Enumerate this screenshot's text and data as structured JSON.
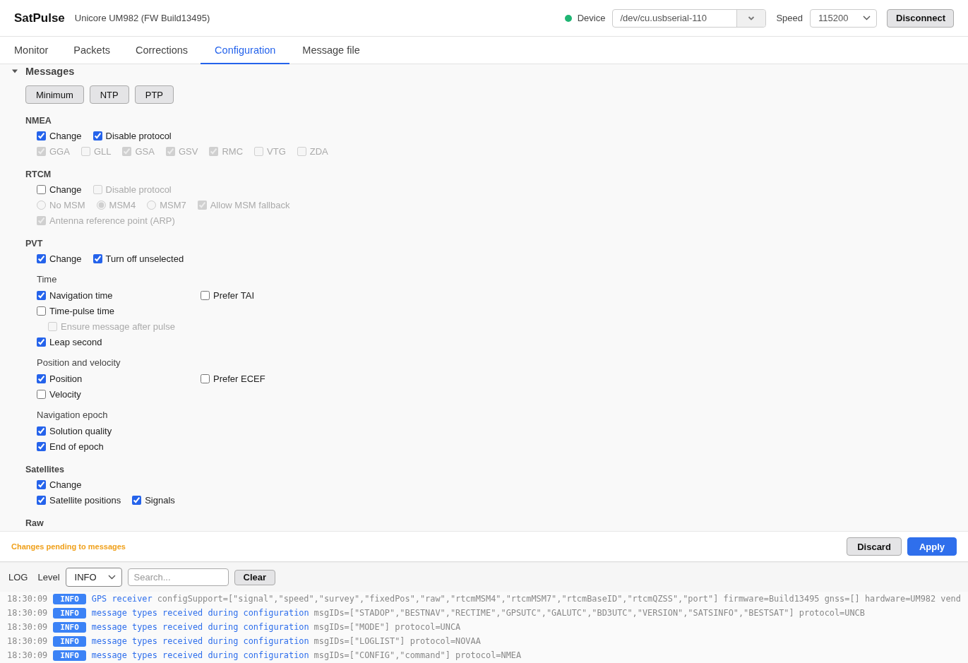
{
  "app": {
    "title": "SatPulse",
    "subtitle": "Unicore UM982 (FW Build13495)"
  },
  "connection": {
    "connected": true,
    "device_label": "Device",
    "device": "/dev/cu.usbserial-110",
    "speed_label": "Speed",
    "speed": "115200",
    "button": "Disconnect"
  },
  "tabs": [
    {
      "label": "Monitor",
      "selected": false
    },
    {
      "label": "Packets",
      "selected": false
    },
    {
      "label": "Corrections",
      "selected": false
    },
    {
      "label": "Configuration",
      "selected": true
    },
    {
      "label": "Message file",
      "selected": false
    }
  ],
  "messages": {
    "title": "Messages",
    "expanded": true,
    "presets": [
      "Minimum",
      "NTP",
      "PTP"
    ],
    "groups": [
      {
        "title": "NMEA",
        "rows": [
          [
            {
              "kind": "checkbox",
              "label": "Change",
              "checked": true,
              "disabled": false
            },
            {
              "kind": "checkbox",
              "label": "Disable protocol",
              "checked": true,
              "disabled": false
            }
          ],
          [
            {
              "kind": "checkbox",
              "label": "GGA",
              "checked": true,
              "disabled": true
            },
            {
              "kind": "checkbox",
              "label": "GLL",
              "checked": false,
              "disabled": true
            },
            {
              "kind": "checkbox",
              "label": "GSA",
              "checked": true,
              "disabled": true
            },
            {
              "kind": "checkbox",
              "label": "GSV",
              "checked": true,
              "disabled": true
            },
            {
              "kind": "checkbox",
              "label": "RMC",
              "checked": true,
              "disabled": true
            },
            {
              "kind": "checkbox",
              "label": "VTG",
              "checked": false,
              "disabled": true
            },
            {
              "kind": "checkbox",
              "label": "ZDA",
              "checked": false,
              "disabled": true
            }
          ]
        ]
      },
      {
        "title": "RTCM",
        "rows": [
          [
            {
              "kind": "checkbox",
              "label": "Change",
              "checked": false,
              "disabled": false
            },
            {
              "kind": "checkbox",
              "label": "Disable protocol",
              "checked": false,
              "disabled": true
            }
          ],
          [
            {
              "kind": "radio",
              "label": "No MSM",
              "selected": false,
              "disabled": true
            },
            {
              "kind": "radio",
              "label": "MSM4",
              "selected": true,
              "disabled": true
            },
            {
              "kind": "radio",
              "label": "MSM7",
              "selected": false,
              "disabled": true
            },
            {
              "kind": "checkbox",
              "label": "Allow MSM fallback",
              "checked": true,
              "disabled": true
            }
          ],
          [
            {
              "kind": "checkbox",
              "label": "Antenna reference point (ARP)",
              "checked": true,
              "disabled": true
            }
          ]
        ]
      },
      {
        "title": "PVT",
        "rows": [
          [
            {
              "kind": "checkbox",
              "label": "Change",
              "checked": true,
              "disabled": false
            },
            {
              "kind": "checkbox",
              "label": "Turn off unselected",
              "checked": true,
              "disabled": false
            }
          ]
        ],
        "subgroups": [
          {
            "title": "Time",
            "rows": [
              [
                {
                  "kind": "checkbox",
                  "label": "Navigation time",
                  "checked": true,
                  "disabled": false
                },
                {
                  "kind": "checkbox",
                  "label": "Prefer TAI",
                  "checked": false,
                  "disabled": false
                }
              ],
              [
                {
                  "kind": "checkbox",
                  "label": "Time-pulse time",
                  "checked": false,
                  "disabled": false,
                  "children": [
                    {
                      "kind": "checkbox",
                      "label": "Ensure message after pulse",
                      "checked": false,
                      "disabled": true
                    }
                  ]
                }
              ],
              [
                {
                  "kind": "checkbox",
                  "label": "Leap second",
                  "checked": true,
                  "disabled": false
                }
              ]
            ]
          },
          {
            "title": "Position and velocity",
            "rows": [
              [
                {
                  "kind": "checkbox",
                  "label": "Position",
                  "checked": true,
                  "disabled": false
                },
                {
                  "kind": "checkbox",
                  "label": "Prefer ECEF",
                  "checked": false,
                  "disabled": false
                }
              ],
              [
                {
                  "kind": "checkbox",
                  "label": "Velocity",
                  "checked": false,
                  "disabled": false
                }
              ]
            ]
          },
          {
            "title": "Navigation epoch",
            "rows": [
              [
                {
                  "kind": "checkbox",
                  "label": "Solution quality",
                  "checked": true,
                  "disabled": false
                }
              ],
              [
                {
                  "kind": "checkbox",
                  "label": "End of epoch",
                  "checked": true,
                  "disabled": false
                }
              ]
            ]
          }
        ]
      },
      {
        "title": "Satellites",
        "rows": [
          [
            {
              "kind": "checkbox",
              "label": "Change",
              "checked": true,
              "disabled": false
            }
          ],
          [
            {
              "kind": "checkbox",
              "label": "Satellite positions",
              "checked": true,
              "disabled": false
            },
            {
              "kind": "checkbox",
              "label": "Signals",
              "checked": true,
              "disabled": false
            }
          ]
        ]
      },
      {
        "title": "Raw"
      }
    ]
  },
  "pending": {
    "message": "Changes pending to messages",
    "buttons": [
      {
        "label": "Discard",
        "kind": "secondary"
      },
      {
        "label": "Apply",
        "kind": "primary"
      }
    ]
  },
  "log": {
    "title": "LOG",
    "level_label": "Level",
    "level": "INFO",
    "search_placeholder": "Search...",
    "clear": "Clear",
    "entries": [
      {
        "time": "18:30:09",
        "level": "INFO",
        "message": "GPS receiver",
        "fields": "configSupport=[\"signal\",\"speed\",\"survey\",\"fixedPos\",\"raw\",\"rtcmMSM4\",\"rtcmMSM7\",\"rtcmBaseID\",\"rtcmQZSS\",\"port\"] firmware=Build13495 gnss=[] hardware=UM982 vend"
      },
      {
        "time": "18:30:09",
        "level": "INFO",
        "message": "message types received during configuration",
        "fields": "msgIDs=[\"STADOP\",\"BESTNAV\",\"RECTIME\",\"GPSUTC\",\"GALUTC\",\"BD3UTC\",\"VERSION\",\"SATSINFO\",\"BESTSAT\"] protocol=UNCB"
      },
      {
        "time": "18:30:09",
        "level": "INFO",
        "message": "message types received during configuration",
        "fields": "msgIDs=[\"MODE\"] protocol=UNCA"
      },
      {
        "time": "18:30:09",
        "level": "INFO",
        "message": "message types received during configuration",
        "fields": "msgIDs=[\"LOGLIST\"] protocol=NOVAA"
      },
      {
        "time": "18:30:09",
        "level": "INFO",
        "message": "message types received during configuration",
        "fields": "msgIDs=[\"CONFIG\",\"command\"] protocol=NMEA"
      }
    ]
  }
}
